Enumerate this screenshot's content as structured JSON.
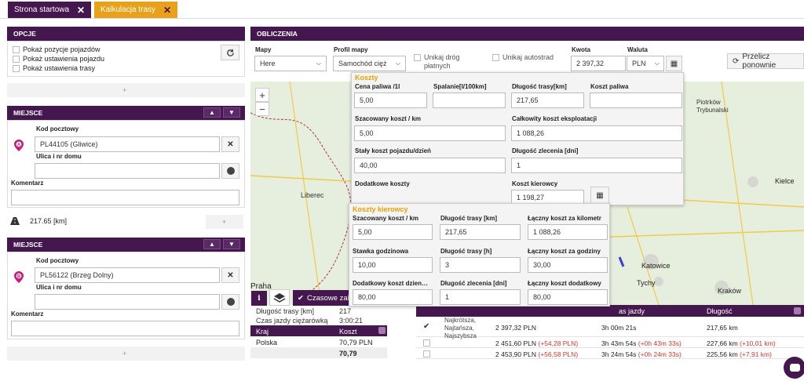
{
  "tabs": [
    {
      "label": "Strona startowa",
      "close": "✕"
    },
    {
      "label": "Kalkulacja trasy",
      "close": "✕"
    }
  ],
  "options": {
    "title": "OPCJE",
    "items": [
      "Pokaż pozycje pojazdów",
      "Pokaż ustawienia pojazdu",
      "Pokaż ustawienia trasy"
    ]
  },
  "place1": {
    "title": "MIEJSCE",
    "postal_label": "Kod pocztowy",
    "postal_value": "PL44105 (Gliwice)",
    "street_label": "Ulica i nr domu",
    "street_value": "",
    "comment_label": "Komentarz",
    "comment_value": "",
    "marker": "A"
  },
  "route_segment": {
    "distance": "217.65 [km]"
  },
  "place2": {
    "title": "MIEJSCE",
    "postal_label": "Kod pocztowy",
    "postal_value": "PL56122 (Brzeg Dolny)",
    "street_label": "Ulica i nr domu",
    "street_value": "",
    "comment_label": "Komentarz",
    "comment_value": "",
    "marker": "B"
  },
  "calc": {
    "title": "OBLICZENIA",
    "maps_label": "Mapy",
    "maps_value": "Here",
    "profile_label": "Profil mapy",
    "profile_value": "Samochód cięż",
    "avoid_toll_label": "Unikaj dróg płatnych",
    "avoid_highway_label": "Unikaj autostrad",
    "amount_label": "Kwota",
    "amount_value": "2 397,32",
    "currency_label": "Waluta",
    "currency_value": "PLN",
    "recalc_label": "Przelicz ponownie"
  },
  "costs": {
    "title": "Koszty",
    "fuel_price_label": "Cena paliwa /1l",
    "fuel_price_value": "5,00",
    "consumption_label": "Spalanie[l/100km]",
    "consumption_value": "",
    "route_length_label": "Długość trasy[km]",
    "route_length_value": "217,65",
    "fuel_cost_label": "Koszt paliwa",
    "fuel_cost_value": "",
    "est_cost_label": "Szacowany koszt / km",
    "est_cost_value": "5,00",
    "total_cost_label": "Całkowity koszt eksploatacji",
    "total_cost_value": "1 088,26",
    "fixed_cost_label": "Stały koszt pojazdu/dzień",
    "fixed_cost_value": "40,00",
    "order_length_label": "Długość zlecenia [dni]",
    "order_length_value": "1",
    "extra_cost_label": "Dodatkowe koszty",
    "driver_cost_label": "Koszt kierowcy",
    "driver_cost_value": "1 198,27"
  },
  "driver_costs": {
    "title": "Koszty kierowcy",
    "est_cost_label": "Szacowany koszt / km",
    "est_cost_value": "5,00",
    "route_km_label": "Długość trasy [km]",
    "route_km_value": "217,65",
    "total_km_label": "Łączny koszt za kilometr",
    "total_km_value": "1 088,26",
    "hourly_label": "Stawka godzinowa",
    "hourly_value": "10,00",
    "route_h_label": "Długość trasy [h]",
    "route_h_value": "3",
    "total_h_label": "Łączny koszt za godziny",
    "total_h_value": "30,00",
    "extra_day_label": "Dodatkowy koszt dzien…",
    "extra_day_value": "80,00",
    "order_days_label": "Długość zlecenia [dni]",
    "order_days_value": "1",
    "total_extra_label": "Łączny koszt dodatkowy",
    "total_extra_value": "80,00"
  },
  "map": {
    "zoom_in": "+",
    "zoom_out": "−",
    "temp_btn": "Czasowe zak",
    "labels": [
      "Liberec",
      "Praha",
      "Katowice",
      "Tychy",
      "Kraków",
      "Kielce",
      "Piotrków Trybunalski"
    ]
  },
  "summary": {
    "rows": [
      {
        "label": "Długość trasy [km]",
        "value": "217"
      },
      {
        "label": "Czas jazdy ciężarówką",
        "value": "3:00:21"
      }
    ],
    "country_header": "Kraj",
    "cost_header": "Koszt",
    "country": "Polska",
    "cost": "70,79 PLN",
    "total": "70,79"
  },
  "routes": {
    "header_time": "as jazdy",
    "header_length": "Długość",
    "rows": [
      {
        "name": "Najkrótsza, Najtańsza, Najszybsza",
        "cost": "2 397,32 PLN",
        "cost_diff": "",
        "time": "3h 00m 21s",
        "time_diff": "",
        "length": "217,65 km",
        "length_diff": ""
      },
      {
        "name": "",
        "cost": "2 451,60 PLN",
        "cost_diff": "(+54,28 PLN)",
        "time": "3h 43m 54s",
        "time_diff": "(+0h 43m 33s)",
        "length": "227,66 km",
        "length_diff": "(+10,01 km)"
      },
      {
        "name": "",
        "cost": "2 453,90 PLN",
        "cost_diff": "(+56,58 PLN)",
        "time": "3h 24m 54s",
        "time_diff": "(+0h 24m 33s)",
        "length": "225,56 km",
        "length_diff": "(+7,91 km)"
      }
    ]
  },
  "colors": {
    "purple": "#45174f",
    "orange_tab": "#e8a21a",
    "accent": "#c21d7a"
  }
}
